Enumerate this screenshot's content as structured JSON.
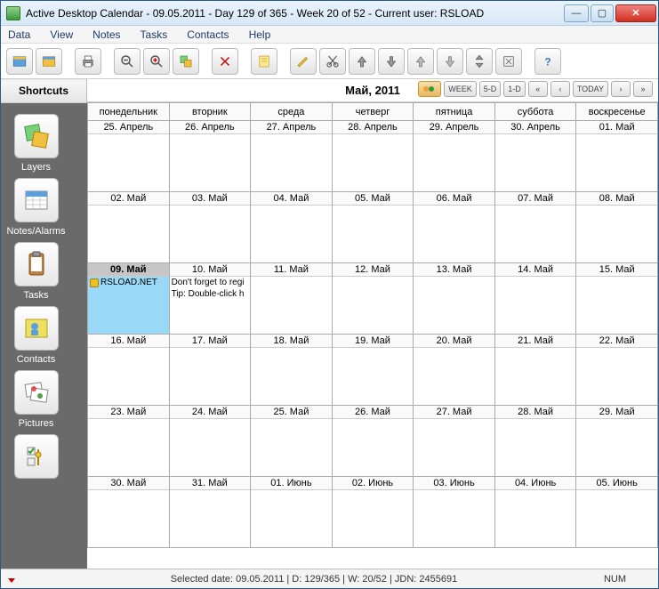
{
  "titlebar": {
    "title": "Active Desktop Calendar - 09.05.2011 - Day 129 of 365 - Week 20 of 52 - Current user: RSLOAD"
  },
  "menu": {
    "items": [
      "Data",
      "View",
      "Notes",
      "Tasks",
      "Contacts",
      "Help"
    ]
  },
  "sidebar": {
    "header": "Shortcuts",
    "items": [
      {
        "label": "Layers"
      },
      {
        "label": "Notes/Alarms"
      },
      {
        "label": "Tasks"
      },
      {
        "label": "Contacts"
      },
      {
        "label": "Pictures"
      },
      {
        "label": ""
      }
    ]
  },
  "calendar": {
    "title": "Май, 2011",
    "nav": {
      "week": "WEEK",
      "d5": "5-D",
      "d1": "1-D",
      "today": "TODAY"
    },
    "dow": [
      "понедельник",
      "вторник",
      "среда",
      "четверг",
      "пятница",
      "суббота",
      "воскресенье"
    ],
    "weeks": [
      [
        {
          "d": "25. Апрель"
        },
        {
          "d": "26. Апрель"
        },
        {
          "d": "27. Апрель"
        },
        {
          "d": "28. Апрель"
        },
        {
          "d": "29. Апрель"
        },
        {
          "d": "30. Апрель"
        },
        {
          "d": "01. Май"
        }
      ],
      [
        {
          "d": "02. Май"
        },
        {
          "d": "03. Май"
        },
        {
          "d": "04. Май"
        },
        {
          "d": "05. Май"
        },
        {
          "d": "06. Май"
        },
        {
          "d": "07. Май"
        },
        {
          "d": "08. Май"
        }
      ],
      [
        {
          "d": "09. Май",
          "sel": true,
          "note": "RSLOAD.NET"
        },
        {
          "d": "10. Май",
          "tips": [
            "Don't forget to regi",
            "Tip: Double-click h"
          ]
        },
        {
          "d": "11. Май"
        },
        {
          "d": "12. Май"
        },
        {
          "d": "13. Май"
        },
        {
          "d": "14. Май"
        },
        {
          "d": "15. Май"
        }
      ],
      [
        {
          "d": "16. Май"
        },
        {
          "d": "17. Май"
        },
        {
          "d": "18. Май"
        },
        {
          "d": "19. Май"
        },
        {
          "d": "20. Май"
        },
        {
          "d": "21. Май"
        },
        {
          "d": "22. Май"
        }
      ],
      [
        {
          "d": "23. Май"
        },
        {
          "d": "24. Май"
        },
        {
          "d": "25. Май"
        },
        {
          "d": "26. Май"
        },
        {
          "d": "27. Май"
        },
        {
          "d": "28. Май"
        },
        {
          "d": "29. Май"
        }
      ],
      [
        {
          "d": "30. Май"
        },
        {
          "d": "31. Май"
        },
        {
          "d": "01. Июнь"
        },
        {
          "d": "02. Июнь"
        },
        {
          "d": "03. Июнь"
        },
        {
          "d": "04. Июнь"
        },
        {
          "d": "05. Июнь"
        }
      ]
    ]
  },
  "statusbar": {
    "center": "Selected date: 09.05.2011 | D: 129/365 | W: 20/52 | JDN: 2455691",
    "num": "NUM"
  }
}
